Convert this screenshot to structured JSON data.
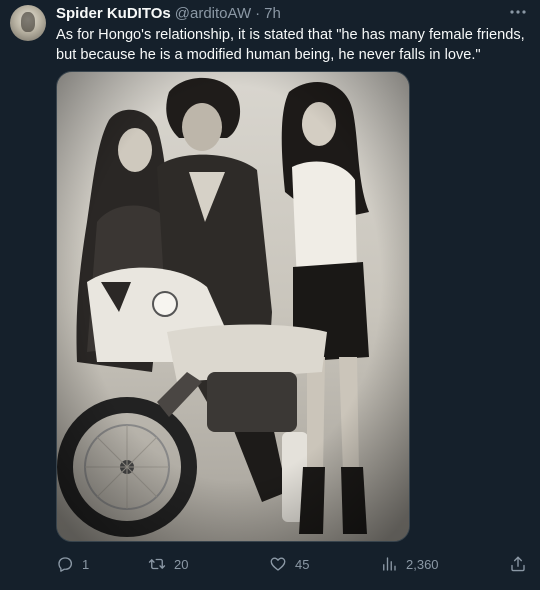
{
  "tweet": {
    "display_name": "Spider KuDITOs",
    "handle": "@arditoAW",
    "separator": "·",
    "time": "7h",
    "text": "As for Hongo's relationship, it is stated that \"he has many female friends, but because he is a modified human being, he never falls in love.\"",
    "media_icon": "photo"
  },
  "actions": {
    "reply_count": "1",
    "retweet_count": "20",
    "like_count": "45",
    "view_count": "2,360"
  },
  "icons": {
    "reply": "speech-bubble-icon",
    "retweet": "retweet-arrows-icon",
    "like": "heart-icon",
    "views": "bar-chart-icon",
    "share": "share-upload-icon",
    "more": "ellipsis-icon"
  },
  "colors": {
    "background": "#15202b",
    "primary_text": "#f7f9f9",
    "secondary_text": "#8b98a5",
    "border": "#38444d"
  }
}
